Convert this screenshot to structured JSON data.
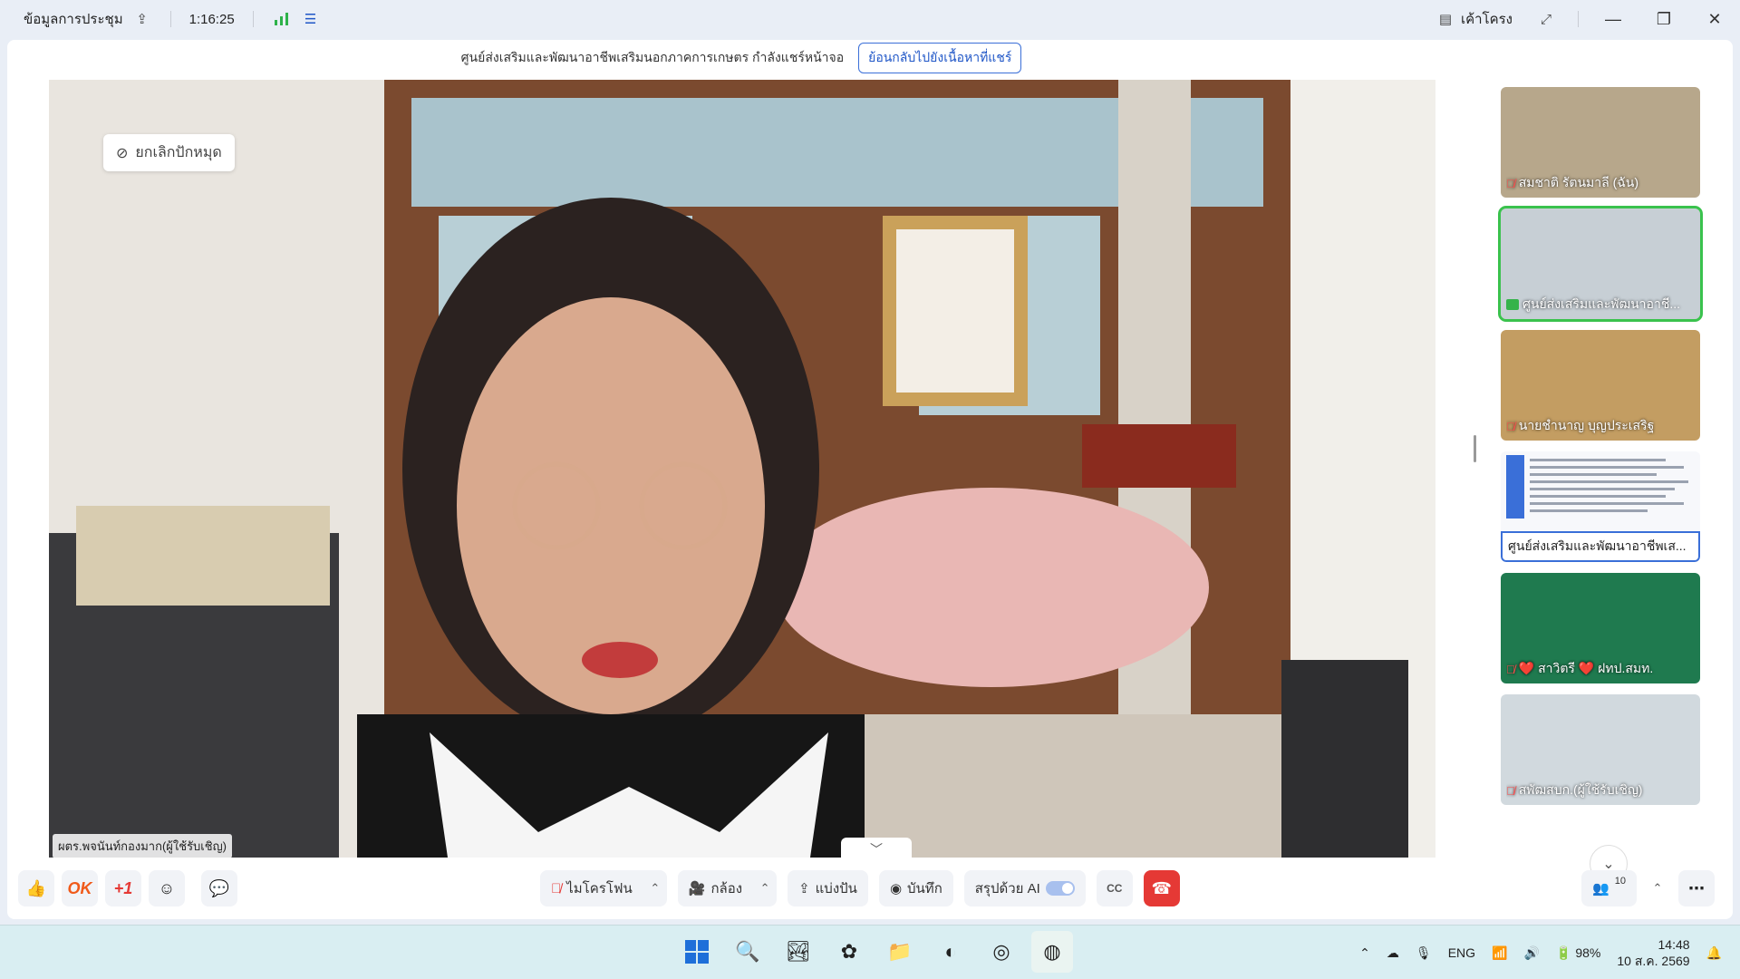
{
  "titlebar": {
    "meeting_info": "ข้อมูลการประชุม",
    "timer": "1:16:25",
    "layout_label": "เค้าโครง"
  },
  "sharebar": {
    "message": "ศูนย์ส่งเสริมและพัฒนาอาชีพเสริมนอกภาคการเกษตร กำลังแชร์หน้าจอ",
    "back_button": "ย้อนกลับไปยังเนื้อหาที่แชร์"
  },
  "main_video": {
    "unpin_label": "ยกเลิกปักหมุด",
    "speaker_name": "ผตร.พจนันท์กองมาก(ผู้ใช้รับเชิญ)"
  },
  "participants": [
    {
      "name": "สมชาติ รัตนมาลี (ฉัน)",
      "muted": true,
      "type": "video"
    },
    {
      "name": "ศูนย์ส่งเสริมและพัฒนาอาชี...",
      "muted": false,
      "sharing": true,
      "type": "video",
      "active": true
    },
    {
      "name": "นายชำนาญ บุญประเสริฐ",
      "muted": true,
      "type": "video"
    },
    {
      "name": "ศูนย์ส่งเสริมและพัฒนาอาชีพเส...",
      "muted": false,
      "type": "document"
    },
    {
      "name": "❤️ สาวิตรี ❤️ ฝทป.สมท.",
      "muted": true,
      "type": "video"
    },
    {
      "name": "สพัฒสบก.(ผู้ใช้รับเชิญ)",
      "muted": true,
      "type": "video"
    }
  ],
  "toolbar": {
    "ok_label": "OK",
    "plus_one_label": "+1",
    "mic_label": "ไมโครโฟน",
    "camera_label": "กล้อง",
    "share_label": "แบ่งปัน",
    "record_label": "บันทึก",
    "ai_summary_label": "สรุปด้วย AI",
    "cc_label": "CC",
    "participant_count": "10"
  },
  "taskbar": {
    "lang": "ENG",
    "battery": "98%",
    "time": "14:48",
    "date": "10 ส.ค. 2569"
  },
  "colors": {
    "accent": "#3a6fd8",
    "end_call": "#e53935",
    "active_border": "#3ac24d",
    "signal": "#2eb24a"
  }
}
